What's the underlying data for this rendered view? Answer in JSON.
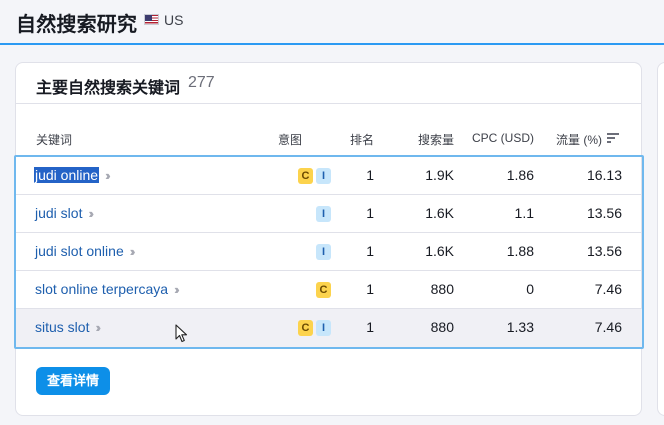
{
  "header": {
    "title": "自然搜索研究",
    "database": "US"
  },
  "card": {
    "title": "主要自然搜索关键词",
    "count": "277",
    "columns": {
      "keyword": "关键词",
      "intent": "意图",
      "position": "排名",
      "volume": "搜索量",
      "cpc": "CPC (USD)",
      "traffic": "流量 (%)"
    },
    "rows": [
      {
        "keyword": "judi online",
        "intents": [
          "C",
          "I"
        ],
        "position": "1",
        "volume": "1.9K",
        "cpc": "1.86",
        "traffic": "16.13"
      },
      {
        "keyword": "judi slot",
        "intents": [
          "I"
        ],
        "position": "1",
        "volume": "1.6K",
        "cpc": "1.1",
        "traffic": "13.56"
      },
      {
        "keyword": "judi slot online",
        "intents": [
          "I"
        ],
        "position": "1",
        "volume": "1.6K",
        "cpc": "1.88",
        "traffic": "13.56"
      },
      {
        "keyword": "slot online terpercaya",
        "intents": [
          "C"
        ],
        "position": "1",
        "volume": "880",
        "cpc": "0",
        "traffic": "7.46"
      },
      {
        "keyword": "situs slot",
        "intents": [
          "C",
          "I"
        ],
        "position": "1",
        "volume": "880",
        "cpc": "1.33",
        "traffic": "7.46"
      }
    ],
    "details_label": "查看详情"
  },
  "colors": {
    "accent": "#2b9af3",
    "link": "#1e5fae",
    "button": "#0d8fe8",
    "commercial_badge": "#fcd34d",
    "informational_badge": "#c7e6fb"
  }
}
